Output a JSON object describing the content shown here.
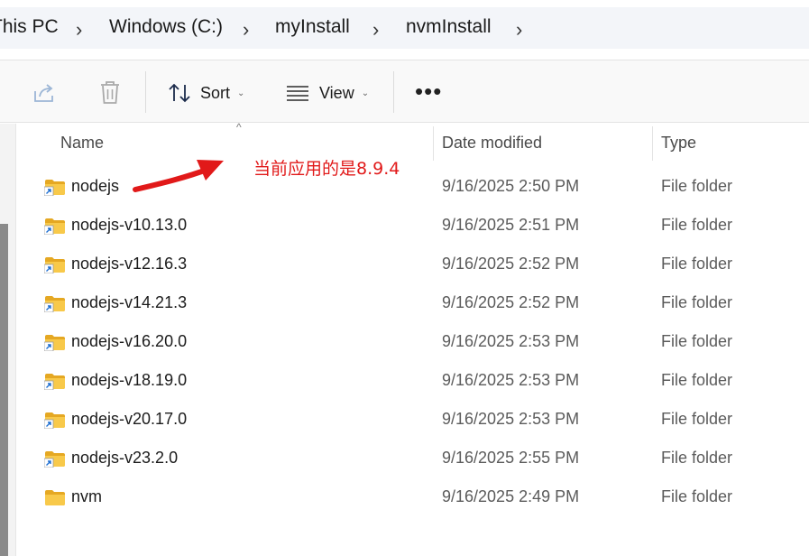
{
  "breadcrumb": {
    "items": [
      "This PC",
      "Windows (C:)",
      "myInstall",
      "nvmInstall"
    ]
  },
  "toolbar": {
    "share_icon": "share-icon",
    "delete_icon": "trash-icon",
    "sort_label": "Sort",
    "view_label": "View",
    "more_label": "•••"
  },
  "columns": {
    "name": "Name",
    "date": "Date modified",
    "type": "Type"
  },
  "files": [
    {
      "name": "nodejs",
      "date": "9/16/2025 2:50 PM",
      "type": "File folder",
      "shortcut": true
    },
    {
      "name": "nodejs-v10.13.0",
      "date": "9/16/2025 2:51 PM",
      "type": "File folder",
      "shortcut": true
    },
    {
      "name": "nodejs-v12.16.3",
      "date": "9/16/2025 2:52 PM",
      "type": "File folder",
      "shortcut": true
    },
    {
      "name": "nodejs-v14.21.3",
      "date": "9/16/2025 2:52 PM",
      "type": "File folder",
      "shortcut": true
    },
    {
      "name": "nodejs-v16.20.0",
      "date": "9/16/2025 2:53 PM",
      "type": "File folder",
      "shortcut": true
    },
    {
      "name": "nodejs-v18.19.0",
      "date": "9/16/2025 2:53 PM",
      "type": "File folder",
      "shortcut": true
    },
    {
      "name": "nodejs-v20.17.0",
      "date": "9/16/2025 2:53 PM",
      "type": "File folder",
      "shortcut": true
    },
    {
      "name": "nodejs-v23.2.0",
      "date": "9/16/2025 2:55 PM",
      "type": "File folder",
      "shortcut": true
    },
    {
      "name": "nvm",
      "date": "9/16/2025 2:49 PM",
      "type": "File folder",
      "shortcut": false
    }
  ],
  "annotation": {
    "text": "当前应用的是8.9.4",
    "color": "#e11919"
  },
  "colors": {
    "folder": "#f8c94a",
    "folder_dark": "#e5a823",
    "shortcut_arrow": "#1f6fd1"
  }
}
